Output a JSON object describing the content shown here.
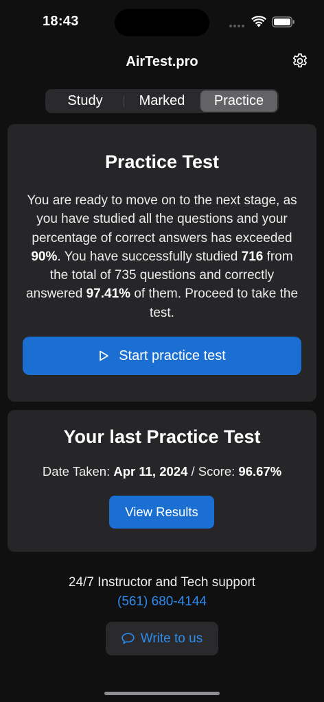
{
  "status_bar": {
    "time": "18:43"
  },
  "nav": {
    "title": "AirTest.pro",
    "settings_icon": "gear-icon"
  },
  "tabs": [
    {
      "label": "Study",
      "selected": false
    },
    {
      "label": "Marked",
      "selected": false
    },
    {
      "label": "Practice",
      "selected": true
    }
  ],
  "practice_card": {
    "title": "Practice Test",
    "desc_part1": "You are ready to move on to the next stage, as you have studied all the questions and your percentage of correct answers has exceeded ",
    "threshold": "90%",
    "desc_part2": ". You have successfully studied ",
    "studied_count": "716",
    "desc_part3": " from the total of 735 questions and correctly answered ",
    "correct_percent": "97.41%",
    "desc_part4": " of them. Proceed to take the test.",
    "start_button_label": "Start practice test",
    "start_button_icon": "play-icon"
  },
  "last_test_card": {
    "title": "Your last Practice Test",
    "date_label": "Date Taken: ",
    "date_value": "Apr 11, 2024",
    "separator": " / ",
    "score_label": "Score: ",
    "score_value": "96.67%",
    "view_results_label": "View Results"
  },
  "support": {
    "text": "24/7 Instructor and Tech support",
    "phone": "(561) 680-4144",
    "write_button_label": "Write to us",
    "write_button_icon": "chat-bubble-icon"
  },
  "colors": {
    "background": "#101010",
    "card": "#262628",
    "accent_button": "#1b6fd2",
    "link": "#2d8cf0"
  }
}
